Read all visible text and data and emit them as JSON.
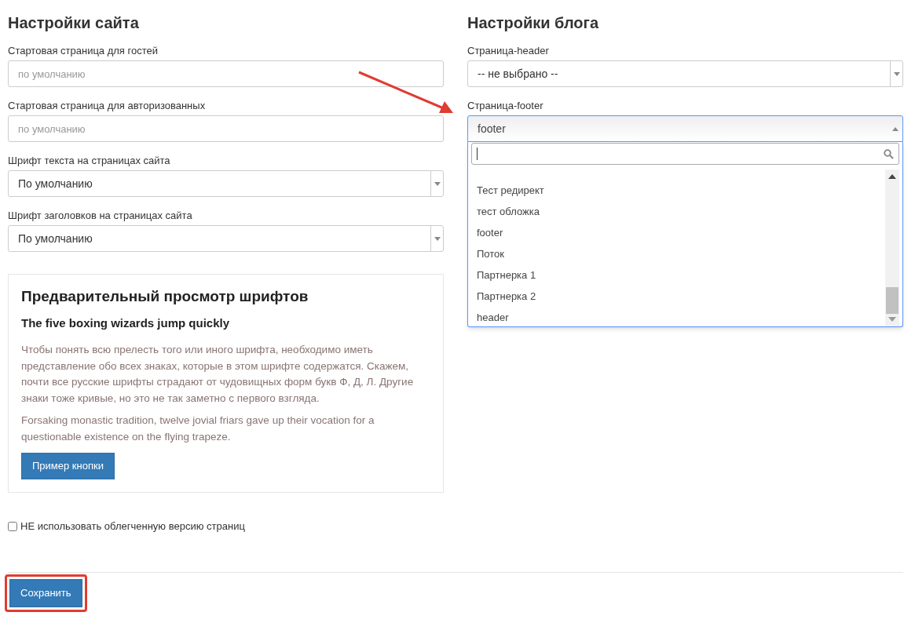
{
  "site_settings": {
    "title": "Настройки сайта",
    "fields": [
      {
        "kind": "input",
        "label": "Стартовая страница для гостей",
        "placeholder": "по умолчанию"
      },
      {
        "kind": "input",
        "label": "Стартовая страница для авторизованных",
        "placeholder": "по умолчанию"
      },
      {
        "kind": "select",
        "label": "Шрифт текста на страницах сайта",
        "value": "По умолчанию",
        "expanded": false
      },
      {
        "kind": "select",
        "label": "Шрифт заголовков на страницах сайта",
        "value": "По умолчанию",
        "expanded": false
      }
    ]
  },
  "font_preview": {
    "title": "Предварительный просмотр шрифтов",
    "sample_heading": "The five boxing wizards jump quickly",
    "paragraphs": [
      "Чтобы понять всю прелесть того или иного шрифта, необходимо иметь представление обо всех знаках, которые в этом шрифте содержатся. Скажем, почти все русские шрифты страдают от чудовищных форм букв Ф, Д, Л. Другие знаки тоже кривые, но это не так заметно с первого взгляда.",
      "Forsaking monastic tradition, twelve jovial friars gave up their vocation for a questionable existence on the flying trapeze."
    ],
    "button": "Пример кнопки"
  },
  "lite_version": {
    "label": "НЕ использовать облегченную версию страниц",
    "checked": false
  },
  "blog_settings": {
    "title": "Настройки блога",
    "fields": [
      {
        "kind": "select",
        "label": "Страница-header",
        "value": "-- не выбрано --",
        "expanded": false
      },
      {
        "kind": "select",
        "label": "Страница-footer",
        "value": "footer",
        "expanded": true
      }
    ]
  },
  "dropdown": {
    "options": [
      "Тест редирект",
      "тест обложка",
      "footer",
      "Поток",
      "Партнерка 1",
      "Партнерка 2",
      "header"
    ]
  },
  "save_button": "Сохранить"
}
